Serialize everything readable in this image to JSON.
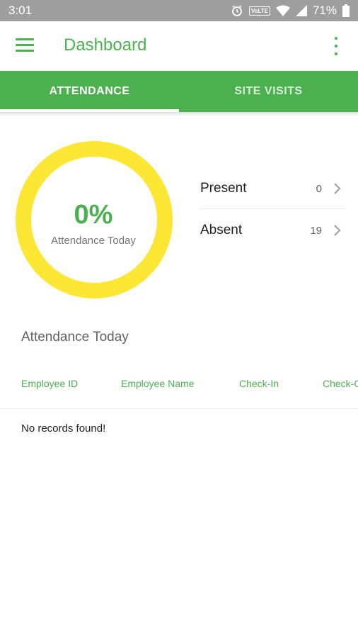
{
  "status_bar": {
    "time": "3:01",
    "volte": "VoLTE",
    "battery": "71%"
  },
  "app_bar": {
    "title": "Dashboard"
  },
  "tabs": [
    {
      "label": "ATTENDANCE",
      "active": true
    },
    {
      "label": "SITE VISITS",
      "active": false
    }
  ],
  "summary": {
    "percentage": "0%",
    "caption": "Attendance Today",
    "ring_fraction": 0,
    "ring_color": "#fde735",
    "present": {
      "label": "Present",
      "count": "0"
    },
    "absent": {
      "label": "Absent",
      "count": "19"
    }
  },
  "attendance_table": {
    "title": "Attendance Today",
    "columns": [
      "Employee ID",
      "Employee Name",
      "Check-In",
      "Check-Out"
    ],
    "empty_message": "No records found!"
  },
  "colors": {
    "primary": "#4caf50",
    "status_bar": "#9e9e9e",
    "ring": "#fde735"
  }
}
